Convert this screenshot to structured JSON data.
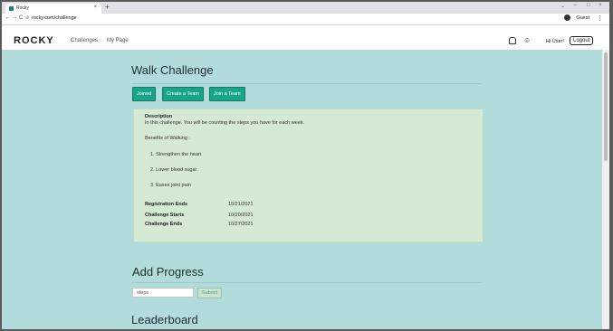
{
  "browser": {
    "tab_title": "Rocky",
    "tab_close": "×",
    "new_tab": "+",
    "window_controls": [
      "⌄",
      "–",
      "□",
      "×"
    ],
    "url": "rocky.com/challenge",
    "profile_label": "Guest",
    "menu_glyph": "⋮",
    "nav_glyphs": {
      "back": "←",
      "forward": "→",
      "reload": "C",
      "lock": "⊘"
    }
  },
  "navbar": {
    "brand": "ROCKY",
    "links": [
      "Challenges",
      "My Page"
    ],
    "greeting": "Hi User!",
    "logout_label": "Logout"
  },
  "challenge": {
    "title": "Walk Challenge",
    "buttons": [
      "Joined",
      "Create a Team",
      "Join a Team"
    ],
    "description_heading": "Description",
    "description_text": "In this challenge. You will be counting the steps you have for each week.",
    "benefits_heading": "Benefits of Walking :",
    "benefits": [
      "1. Strengthen the heart",
      "2. Lower blood sugar",
      "3. Eases joint pain"
    ],
    "dates": [
      {
        "label": "Registration Ends",
        "value": "10/21/2021"
      },
      {
        "label": "Challenge Starts",
        "value": "10/20/2021"
      },
      {
        "label": "Challenge Ends",
        "value": "10/27/2021"
      }
    ]
  },
  "progress": {
    "title": "Add Progress",
    "input_value": "steps",
    "submit_label": "Submit"
  },
  "leaderboard": {
    "title": "Leaderboard"
  },
  "colors": {
    "page_bg": "#b2dcdc",
    "button_bg": "#17a589",
    "card_bg": "#d4ead4"
  }
}
